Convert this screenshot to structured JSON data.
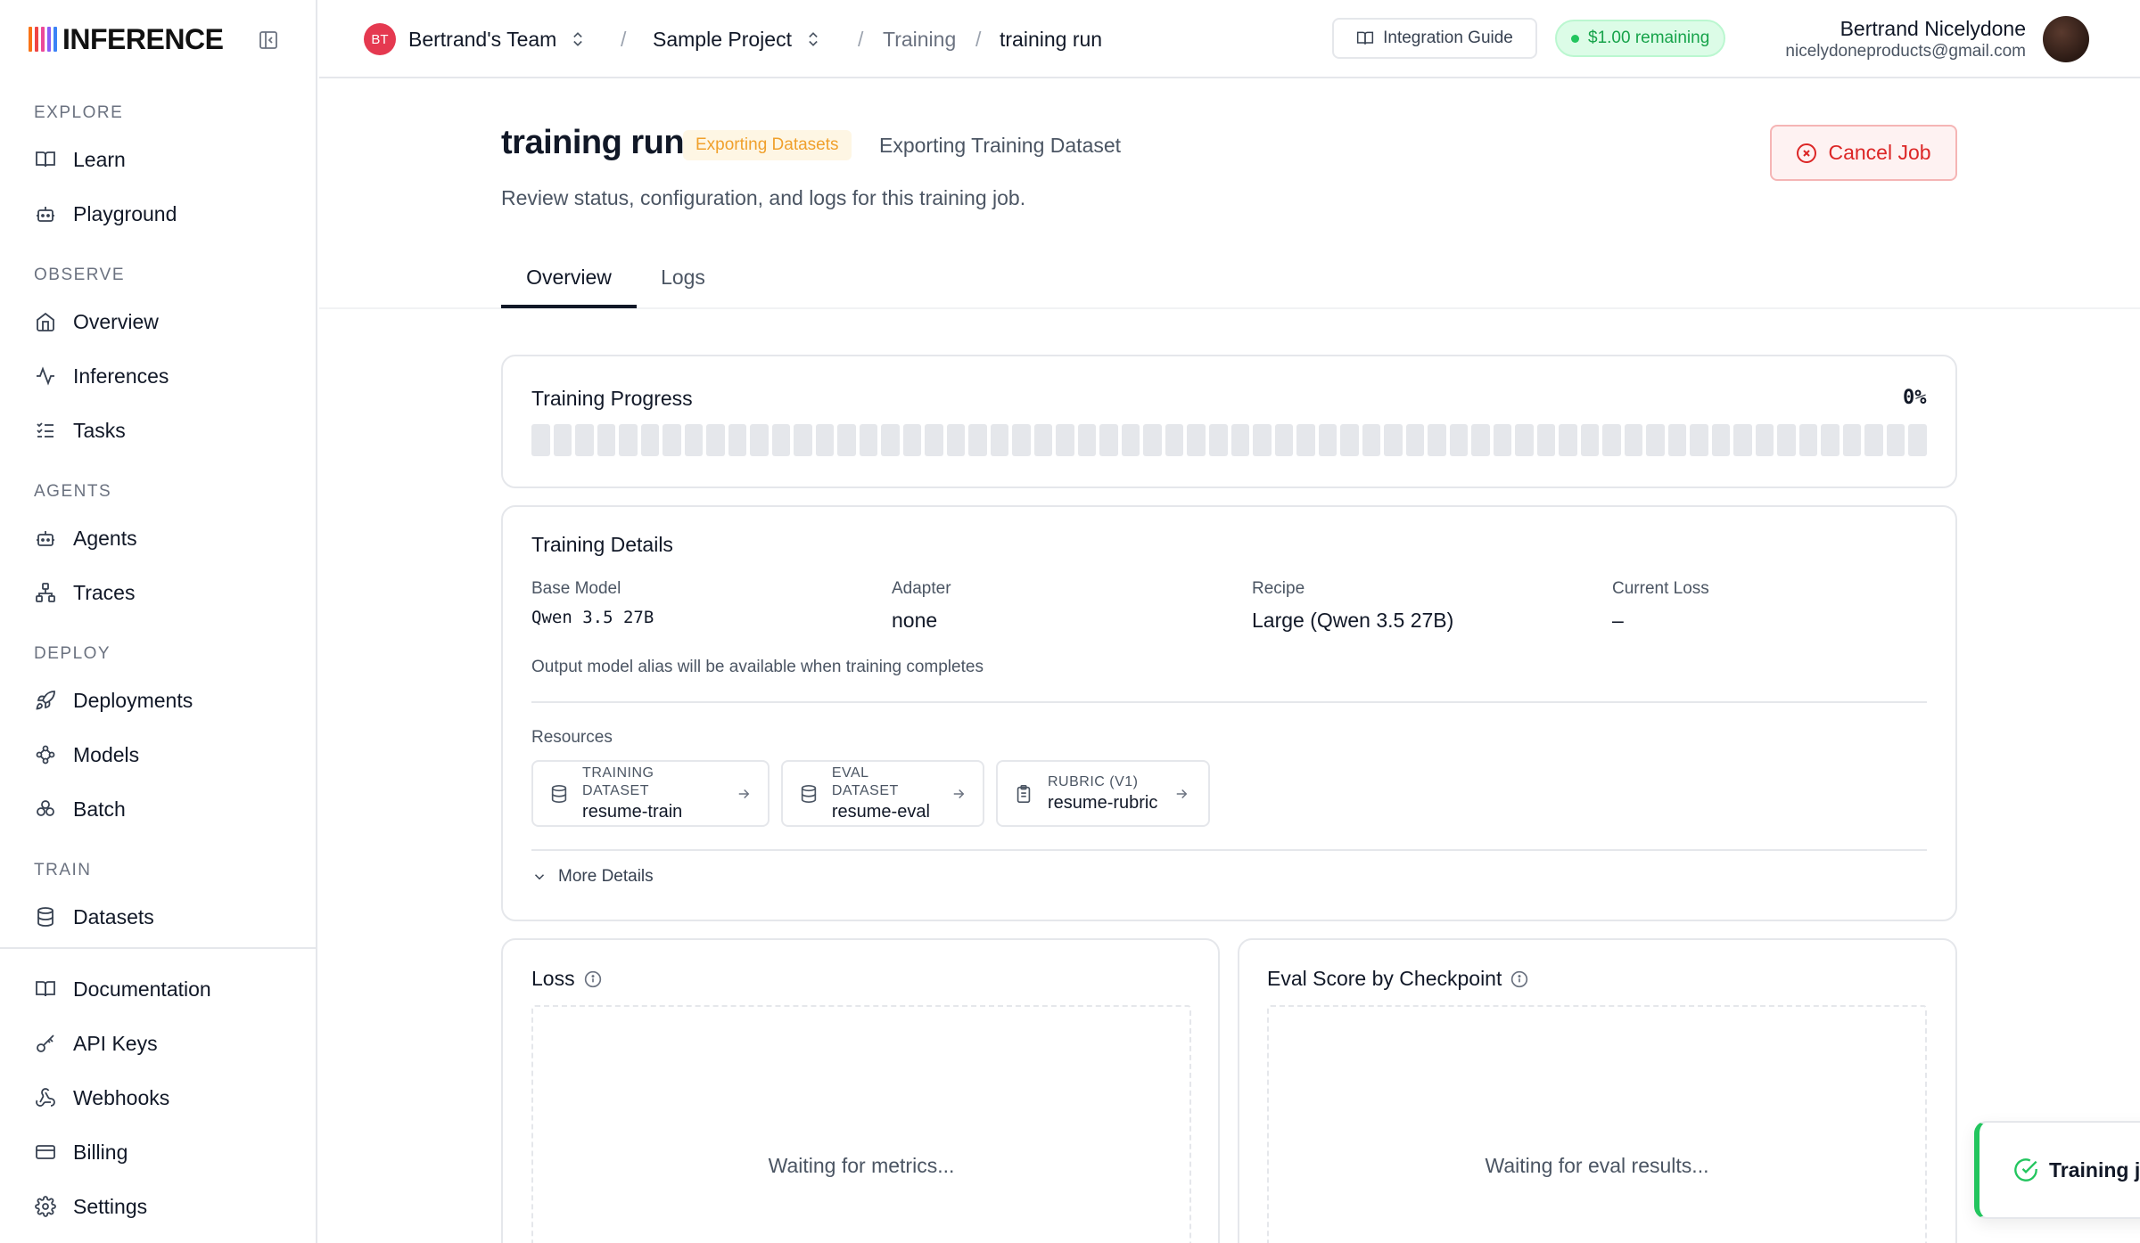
{
  "app": {
    "logo_text": "INFERENCE",
    "logo_colors": [
      "#f97316",
      "#ef4444",
      "#ec4899",
      "#8b5cf6",
      "#3b82f6",
      "#10b981"
    ]
  },
  "sidebar": {
    "sections": {
      "explore": "EXPLORE",
      "observe": "OBSERVE",
      "agents": "AGENTS",
      "deploy": "DEPLOY",
      "train": "TRAIN"
    },
    "items": {
      "learn": "Learn",
      "playground": "Playground",
      "overview": "Overview",
      "inferences": "Inferences",
      "tasks": "Tasks",
      "agents": "Agents",
      "traces": "Traces",
      "deployments": "Deployments",
      "models": "Models",
      "batch": "Batch",
      "datasets": "Datasets",
      "documentation": "Documentation",
      "api_keys": "API Keys",
      "webhooks": "Webhooks",
      "billing": "Billing",
      "settings": "Settings"
    }
  },
  "topbar": {
    "team_initials": "BT",
    "team_name": "Bertrand's Team",
    "project_name": "Sample Project",
    "sep": "/",
    "crumb_training": "Training",
    "crumb_current": "training run",
    "integration_guide": "Integration Guide",
    "credits": "$1.00 remaining",
    "user_name": "Bertrand Nicelydone",
    "user_email": "nicelydoneproducts@gmail.com"
  },
  "header": {
    "title": "training run",
    "status_badge": "Exporting Datasets",
    "status_text": "Exporting Training Dataset",
    "cancel_label": "Cancel Job",
    "subtitle": "Review status, configuration, and logs for this training job."
  },
  "tabs": {
    "overview": "Overview",
    "logs": "Logs"
  },
  "progress": {
    "title": "Training Progress",
    "percent_label": "0%",
    "value": 0
  },
  "details": {
    "title": "Training Details",
    "base_model_label": "Base Model",
    "base_model_value": "Qwen 3.5 27B",
    "adapter_label": "Adapter",
    "adapter_value": "none",
    "recipe_label": "Recipe",
    "recipe_value": "Large (Qwen 3.5 27B)",
    "loss_label": "Current Loss",
    "loss_value": "–",
    "alias_hint": "Output model alias will be available when training completes",
    "resources_label": "Resources",
    "resources": [
      {
        "kind": "TRAINING DATASET",
        "name": "resume-train"
      },
      {
        "kind": "EVAL DATASET",
        "name": "resume-eval"
      },
      {
        "kind": "RUBRIC (V1)",
        "name": "resume-rubric"
      }
    ],
    "more_details": "More Details"
  },
  "charts": {
    "loss_title": "Loss",
    "loss_placeholder": "Waiting for metrics...",
    "eval_title": "Eval Score by Checkpoint",
    "eval_placeholder": "Waiting for eval results..."
  },
  "toast": {
    "text": "Training jo"
  }
}
